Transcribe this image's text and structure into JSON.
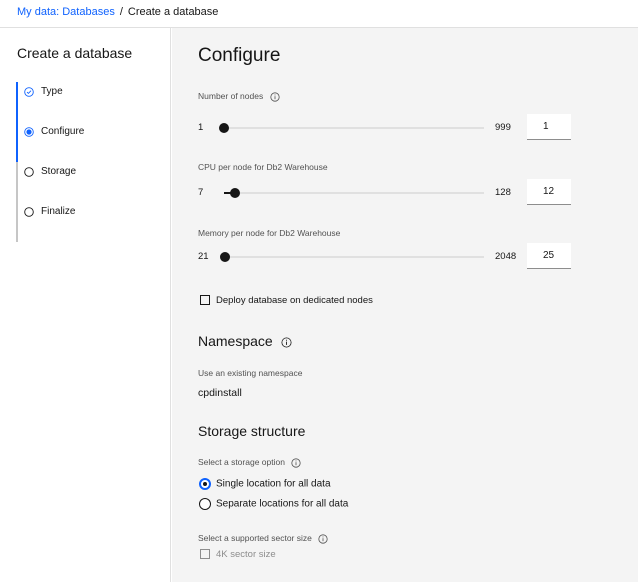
{
  "breadcrumb": {
    "link": "My data: Databases",
    "separator": "/",
    "current": "Create a database"
  },
  "sidebar": {
    "title": "Create a database",
    "steps": [
      {
        "label": "Type",
        "state": "complete"
      },
      {
        "label": "Configure",
        "state": "current"
      },
      {
        "label": "Storage",
        "state": "incomplete"
      },
      {
        "label": "Finalize",
        "state": "incomplete"
      }
    ]
  },
  "main": {
    "title": "Configure",
    "nodes": {
      "label": "Number of nodes",
      "min": "1",
      "max": "999",
      "value": "1",
      "fraction": 0.0
    },
    "cpu": {
      "label": "CPU per node for Db2 Warehouse",
      "min": "7",
      "max": "128",
      "value": "12",
      "fraction": 0.041
    },
    "memory": {
      "label": "Memory per node for Db2 Warehouse",
      "min": "21",
      "max": "2048",
      "value": "25",
      "fraction": 0.002
    },
    "dedicated_nodes_label": "Deploy database on dedicated nodes",
    "namespace": {
      "title": "Namespace",
      "label": "Use an existing namespace",
      "value": "cpdinstall"
    },
    "storage": {
      "title": "Storage structure",
      "option_label": "Select a storage option",
      "options": [
        {
          "label": "Single location for all data",
          "checked": true
        },
        {
          "label": "Separate locations for all data",
          "checked": false
        }
      ],
      "sector_label": "Select a supported sector size",
      "sector_option": "4K sector size"
    }
  },
  "colors": {
    "accent": "#0f62fe",
    "panel_bg": "#f4f4f4",
    "text": "#161616",
    "muted": "#525252"
  }
}
